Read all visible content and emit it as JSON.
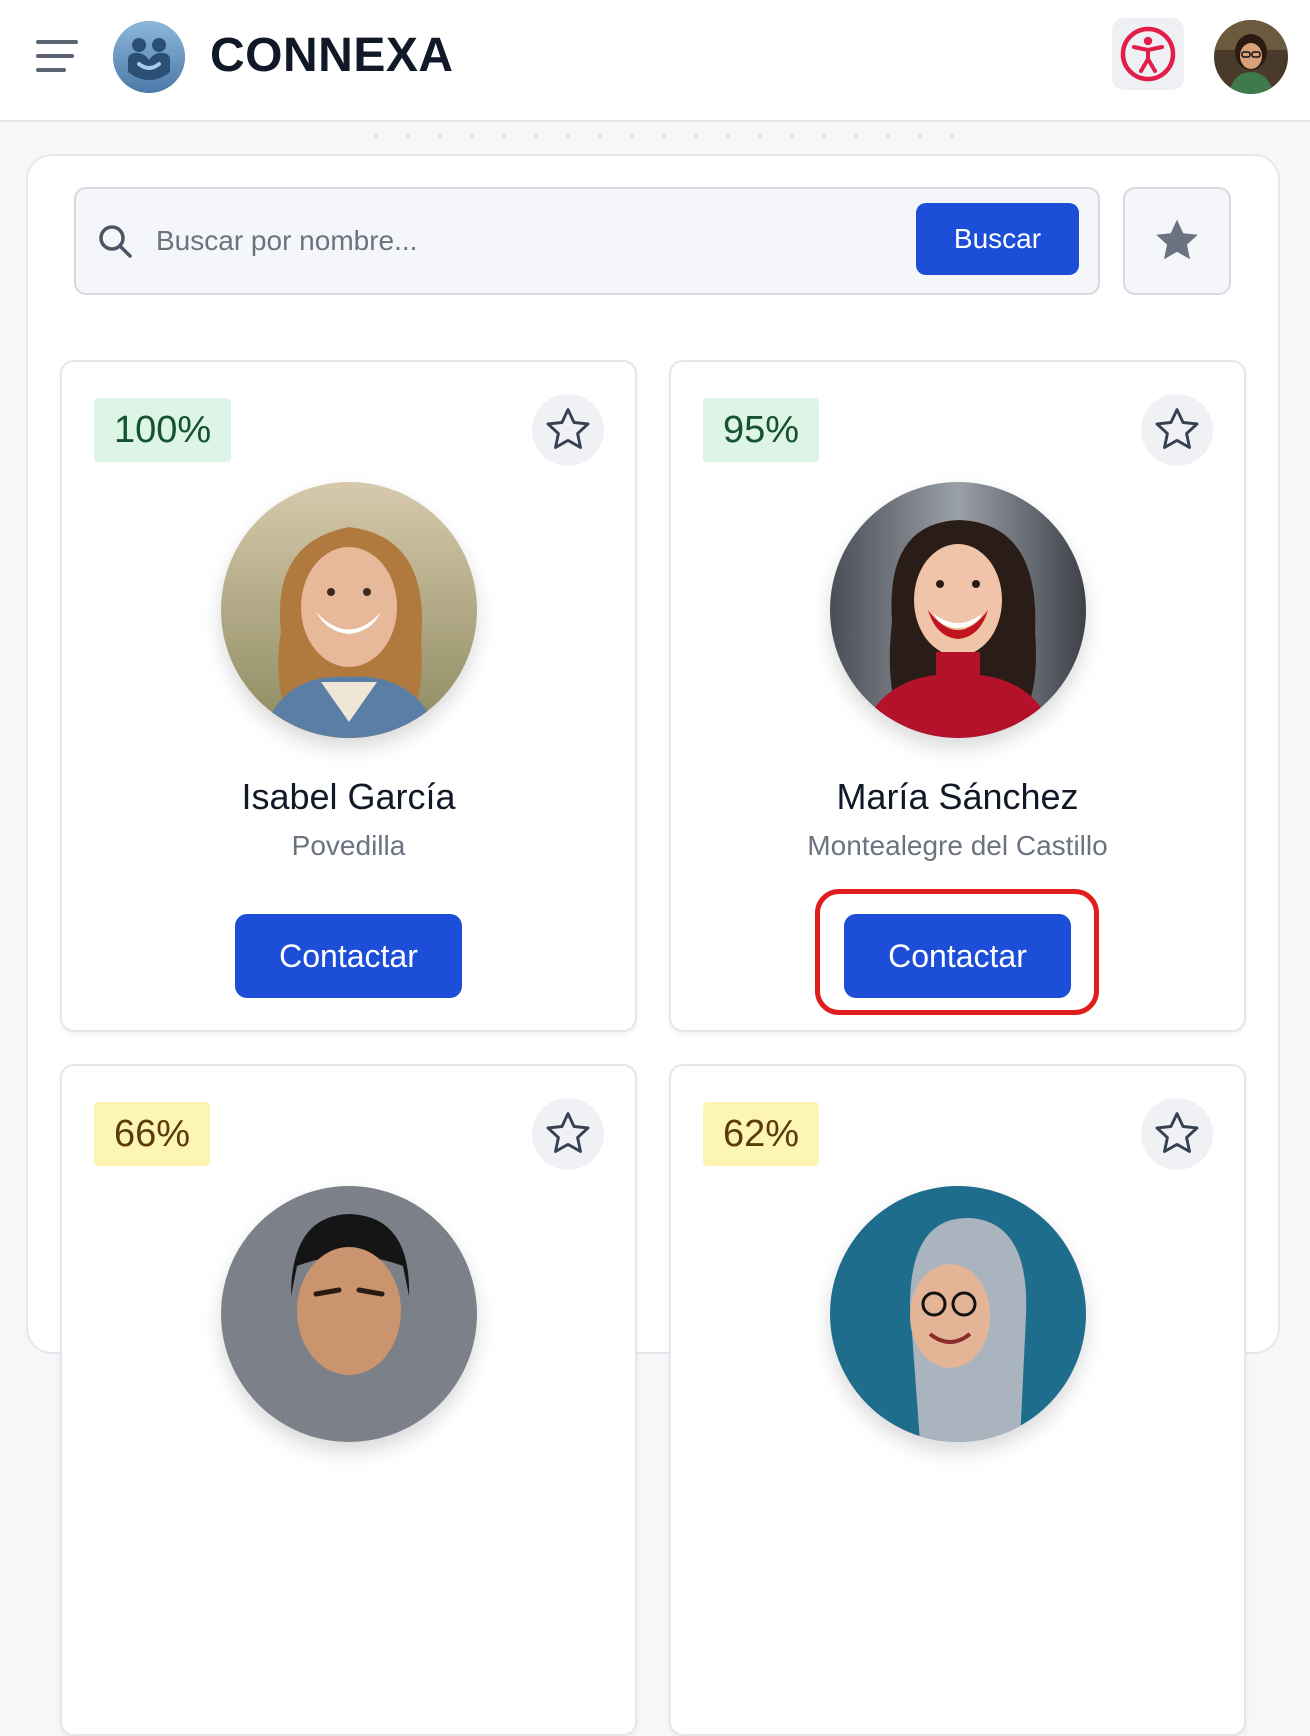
{
  "header": {
    "brand": "CONNEXA",
    "icons": {
      "menu": "hamburger-menu-icon",
      "logo": "connexa-logo-icon",
      "accessibility": "accessibility-icon",
      "avatar": "user-avatar"
    }
  },
  "search": {
    "placeholder": "Buscar por nombre...",
    "value": "",
    "button_label": "Buscar"
  },
  "colors": {
    "primary": "#1d4ed8",
    "accessibility_red": "#e11d48",
    "match_high_bg": "#dcf5e6",
    "match_mid_bg": "#fdf5b3",
    "highlight": "#e11d1d"
  },
  "profiles": [
    {
      "match": "100%",
      "name": "Isabel García",
      "location": "Povedilla",
      "contact_label": "Contactar"
    },
    {
      "match": "95%",
      "name": "María Sánchez",
      "location": "Montealegre del Castillo",
      "contact_label": "Contactar"
    },
    {
      "match": "66%",
      "name": "",
      "location": "",
      "contact_label": ""
    },
    {
      "match": "62%",
      "name": "",
      "location": "",
      "contact_label": ""
    }
  ]
}
